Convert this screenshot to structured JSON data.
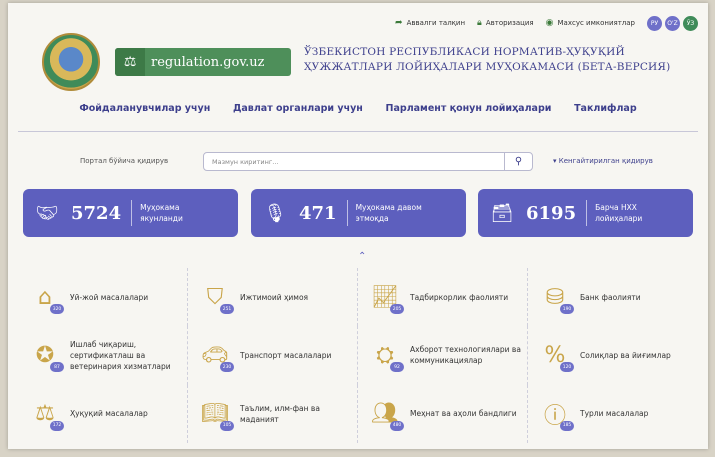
{
  "topbar": {
    "old_version": "Аввалги талқин",
    "login": "Авторизация",
    "accessibility": "Махсус имкониятлар",
    "languages": [
      "РУ",
      "O'Z",
      "ЎЗ"
    ]
  },
  "header": {
    "logo_text": "regulation.gov.uz",
    "title_line1": "ЎЗБЕКИСТОН РЕСПУБЛИКАСИ НОРМАТИВ-ҲУҚУҚИЙ",
    "title_line2": "ҲУЖЖАТЛАРИ ЛОЙИҲАЛАРИ МУҲОКАМАСИ (БЕТА-ВЕРСИЯ)"
  },
  "nav": {
    "items": [
      "Фойдаланувчилар учун",
      "Давлат органлари учун",
      "Парламент қонун лойиҳалари",
      "Таклифлар"
    ]
  },
  "search": {
    "label": "Портал бўйича қидирув",
    "placeholder": "Мазмун киритинг...",
    "advanced": "Кенгайтирилган қидирув"
  },
  "stats": [
    {
      "value": "5724",
      "label": "Муҳокама якунланди"
    },
    {
      "value": "471",
      "label": "Муҳокама давом этмоқда"
    },
    {
      "value": "6195",
      "label": "Барча НХХ лойиҳалари"
    }
  ],
  "categories": [
    {
      "label": "Уй-жой масалалари",
      "count": "320",
      "icon": "house-icon"
    },
    {
      "label": "Ижтимоий ҳимоя",
      "count": "251",
      "icon": "shield-check-icon"
    },
    {
      "label": "Тадбиркорлик фаолияти",
      "count": "205",
      "icon": "growth-chart-icon"
    },
    {
      "label": "Банк фаолияти",
      "count": "190",
      "icon": "coins-icon"
    },
    {
      "label": "Ишлаб чиқариш, сертификатлаш ва ветеринария хизматлари",
      "count": "87",
      "icon": "medal-icon"
    },
    {
      "label": "Транспорт масалалари",
      "count": "230",
      "icon": "car-icon"
    },
    {
      "label": "Ахборот технологиялари ва коммуникациялар",
      "count": "92",
      "icon": "network-icon"
    },
    {
      "label": "Солиқлар ва йиғимлар",
      "count": "120",
      "icon": "percent-doc-icon"
    },
    {
      "label": "Ҳуқуқий масалалар",
      "count": "172",
      "icon": "scales-icon"
    },
    {
      "label": "Таълим, илм-фан ва маданият",
      "count": "105",
      "icon": "book-icon"
    },
    {
      "label": "Меҳнат ва аҳоли бандлиги",
      "count": "480",
      "icon": "workers-icon"
    },
    {
      "label": "Турли масалалар",
      "count": "185",
      "icon": "info-icon"
    }
  ]
}
